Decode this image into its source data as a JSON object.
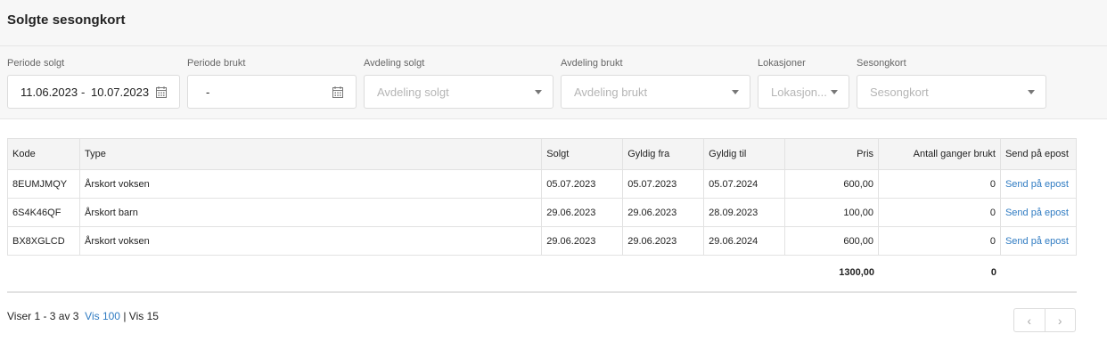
{
  "page": {
    "title": "Solgte sesongkort"
  },
  "filters": {
    "periode_solgt": {
      "label": "Periode solgt",
      "from": "11.06.2023",
      "dash": "-",
      "to": "10.07.2023"
    },
    "periode_brukt": {
      "label": "Periode brukt",
      "value": "-"
    },
    "avdeling_solgt": {
      "label": "Avdeling solgt",
      "placeholder": "Avdeling solgt"
    },
    "avdeling_brukt": {
      "label": "Avdeling brukt",
      "placeholder": "Avdeling brukt"
    },
    "lokasjoner": {
      "label": "Lokasjoner",
      "placeholder": "Lokasjon..."
    },
    "sesongkort": {
      "label": "Sesongkort",
      "placeholder": "Sesongkort"
    }
  },
  "table": {
    "headers": [
      "Kode",
      "Type",
      "Solgt",
      "Gyldig fra",
      "Gyldig til",
      "Pris",
      "Antall ganger brukt",
      "Send på epost"
    ],
    "rows": [
      {
        "kode": "8EUMJMQY",
        "type": "Årskort voksen",
        "solgt": "05.07.2023",
        "fra": "05.07.2023",
        "til": "05.07.2024",
        "pris": "600,00",
        "antall": "0",
        "send": "Send på epost"
      },
      {
        "kode": "6S4K46QF",
        "type": "Årskort barn",
        "solgt": "29.06.2023",
        "fra": "29.06.2023",
        "til": "28.09.2023",
        "pris": "100,00",
        "antall": "0",
        "send": "Send på epost"
      },
      {
        "kode": "BX8XGLCD",
        "type": "Årskort voksen",
        "solgt": "29.06.2023",
        "fra": "29.06.2023",
        "til": "29.06.2024",
        "pris": "600,00",
        "antall": "0",
        "send": "Send på epost"
      }
    ],
    "totals": {
      "pris": "1300,00",
      "antall": "0"
    }
  },
  "pagination": {
    "showing": "Viser 1 - 3 av 3",
    "vis100": "Vis 100",
    "sep": "|",
    "vis15": "Vis 15",
    "prev": "‹",
    "next": "›"
  }
}
